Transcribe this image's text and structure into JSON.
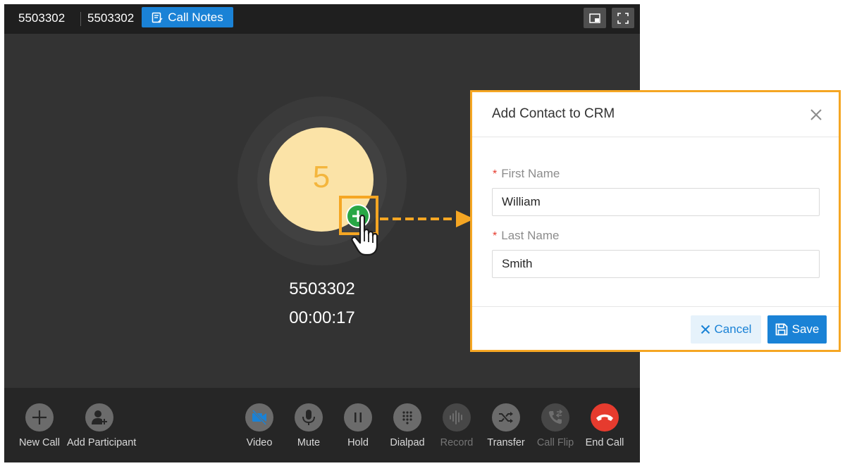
{
  "topbar": {
    "number_left": "5503302",
    "number_right": "5503302",
    "call_notes_label": "Call Notes",
    "icons": {
      "notes": "call-notes-icon",
      "pip": "picture-in-picture-icon",
      "fullscreen": "fullscreen-icon"
    }
  },
  "call": {
    "avatar_initial": "5",
    "callee_number": "5503302",
    "duration": "00:00:17"
  },
  "controls": {
    "new_call": "New Call",
    "add_participant": "Add Participant",
    "video": "Video",
    "mute": "Mute",
    "hold": "Hold",
    "dialpad": "Dialpad",
    "record": "Record",
    "transfer": "Transfer",
    "call_flip": "Call Flip",
    "end_call": "End Call"
  },
  "dialog": {
    "title": "Add Contact to CRM",
    "first_name_label": "First Name",
    "first_name_value": "William",
    "last_name_label": "Last Name",
    "last_name_value": "Smith",
    "required_mark": "*",
    "cancel_label": "Cancel",
    "save_label": "Save"
  },
  "colors": {
    "accent_blue": "#1a82d6",
    "highlight_orange": "#f5a623",
    "end_call_red": "#e63b2e",
    "add_contact_green": "#28a745",
    "avatar_bg": "#fbe3a7",
    "avatar_text": "#f4b63d"
  }
}
